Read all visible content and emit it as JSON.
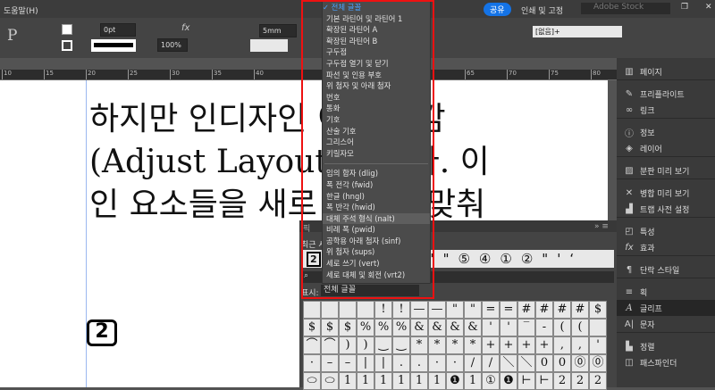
{
  "menubar": {
    "help": "도움말(H)",
    "share": "공유",
    "print": "인쇄 및 고정",
    "stock_placeholder": "Adobe Stock"
  },
  "control": {
    "stroke": "0pt",
    "scale": "100%",
    "gap": "5mm",
    "style": "[없음]+"
  },
  "ruler": [
    "10",
    "15",
    "20",
    "25",
    "30",
    "35",
    "40",
    "65",
    "70",
    "75",
    "80"
  ],
  "document": {
    "lines": [
      "하지만 인디자인 이런 난감",
      "(Adjust Layout) 능이다. 이",
      "인 요소들을 새로 크기에 맞춰"
    ],
    "glyph": "2"
  },
  "menu": {
    "items": [
      "전체 글꼴",
      "기본 라틴어 및 라틴어 1",
      "확장된 라틴어 A",
      "확장된 라틴어 B",
      "구두점",
      "구두점 열기 및 닫기",
      "파선 및 인용 부호",
      "위 첨자 및 아래 첨자",
      "번호",
      "통화",
      "기호",
      "산술 기호",
      "그리스어",
      "키릴자모"
    ],
    "features": [
      "임의 합자 (dlig)",
      "폭 전각 (fwid)",
      "한글 (hngl)",
      "폭 반각 (hwid)",
      "대체 주석 형식 (nalt)",
      "비례 폭 (pwid)",
      "공학용 아래 첨자 (sinf)",
      "위 첨자 (sups)",
      "세로 쓰기 (vert)",
      "세로 대체 및 회전 (vrt2)"
    ]
  },
  "glyph_panel": {
    "tab": "픽",
    "recent_label": "최근 사",
    "show_label": "표시:",
    "show_value": "전체 글꼴",
    "recent": [
      "2",
      "\"",
      "\"",
      "⑤",
      "④",
      "①",
      "②",
      "\"",
      "'",
      "‘"
    ],
    "grid": [
      "",
      "",
      "",
      "",
      "!",
      "!",
      "—",
      "—",
      "\"",
      "\"",
      "=",
      "=",
      "#",
      "#",
      "#",
      "#",
      "$",
      "$",
      "$",
      "$",
      "%",
      "%",
      "%",
      "&",
      "&",
      "&",
      "&",
      "'",
      "'",
      "‾",
      "-",
      "(",
      "(",
      "",
      "⌒",
      "⌒",
      ")",
      ")",
      "‿",
      "‿",
      "*",
      "*",
      "*",
      "*",
      "+",
      "+",
      "+",
      "+",
      ",",
      ",",
      "'",
      "·",
      "–",
      "–",
      "|",
      "|",
      ".",
      ".",
      "·",
      "·",
      "/",
      "/",
      "＼",
      "＼",
      "0",
      "0",
      "⓪",
      "⓪",
      "⬭",
      "⬭",
      "1",
      "1",
      "1",
      "1",
      "1",
      "1",
      "❶",
      "1",
      "①",
      "❶",
      "⊢",
      "⊢",
      "2",
      "2",
      "2"
    ]
  },
  "right_panel": [
    "페이지",
    "프리플라이트",
    "링크",
    "정보",
    "레이어",
    "분판 미리 보기",
    "병합 미리 보기",
    "트랩 사전 설정",
    "특성",
    "효과",
    "단락 스타일",
    "획",
    "글리프",
    "문자",
    "정렬",
    "패스파인더"
  ]
}
